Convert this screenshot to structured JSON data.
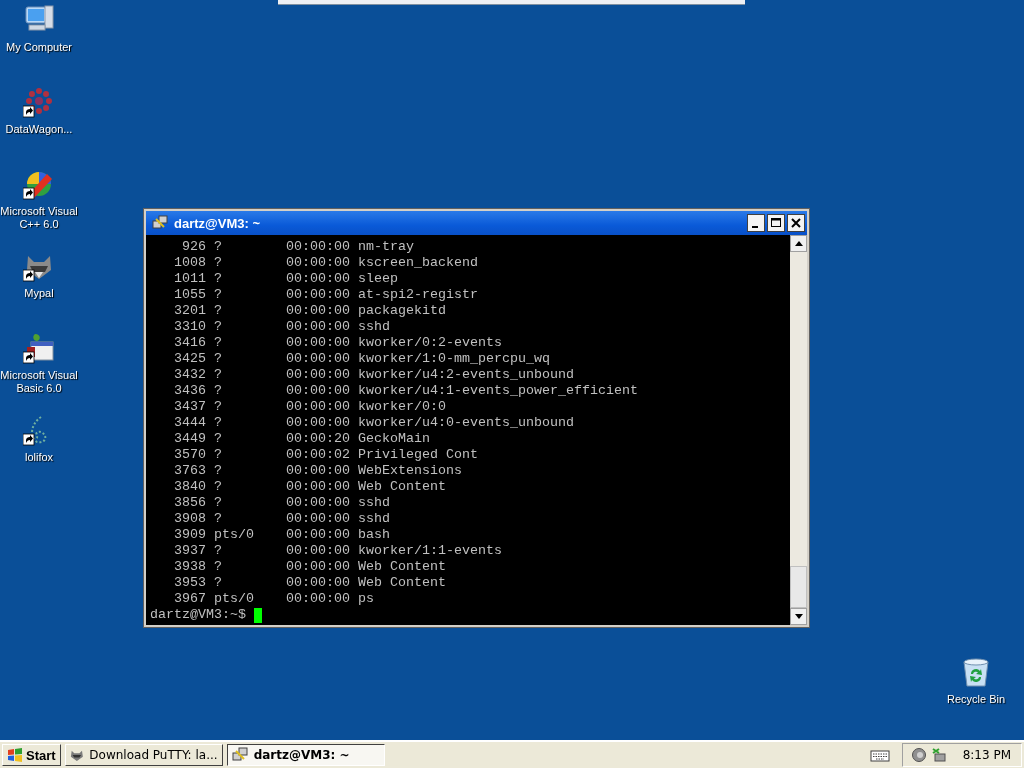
{
  "desktop_icons": [
    {
      "label": "My Computer",
      "kind": "computer",
      "shortcut": false
    },
    {
      "label": "DataWagon...",
      "kind": "dots",
      "shortcut": true
    },
    {
      "label": "Microsoft Visual C++ 6.0",
      "kind": "studio",
      "shortcut": true
    },
    {
      "label": "Mypal",
      "kind": "animal",
      "shortcut": true
    },
    {
      "label": "Microsoft Visual Basic 6.0",
      "kind": "basic",
      "shortcut": true
    },
    {
      "label": "lolifox",
      "kind": "outline",
      "shortcut": true
    }
  ],
  "terminal": {
    "title": "dartz@VM3: ~",
    "lines": [
      "    926 ?        00:00:00 nm-tray",
      "   1008 ?        00:00:00 kscreen_backend",
      "   1011 ?        00:00:00 sleep",
      "   1055 ?        00:00:00 at-spi2-registr",
      "   3201 ?        00:00:00 packagekitd",
      "   3310 ?        00:00:00 sshd",
      "   3416 ?        00:00:00 kworker/0:2-events",
      "   3425 ?        00:00:00 kworker/1:0-mm_percpu_wq",
      "   3432 ?        00:00:00 kworker/u4:2-events_unbound",
      "   3436 ?        00:00:00 kworker/u4:1-events_power_efficient",
      "   3437 ?        00:00:00 kworker/0:0",
      "   3444 ?        00:00:00 kworker/u4:0-events_unbound",
      "   3449 ?        00:00:20 GeckoMain",
      "   3570 ?        00:00:02 Privileged Cont",
      "   3763 ?        00:00:00 WebExtensions",
      "   3840 ?        00:00:00 Web Content",
      "   3856 ?        00:00:00 sshd",
      "   3908 ?        00:00:00 sshd",
      "   3909 pts/0    00:00:00 bash",
      "   3937 ?        00:00:00 kworker/1:1-events",
      "   3938 ?        00:00:00 Web Content",
      "   3953 ?        00:00:00 Web Content",
      "   3967 pts/0    00:00:00 ps"
    ],
    "prompt": "dartz@VM3:~$"
  },
  "recycle_bin": {
    "label": "Recycle Bin"
  },
  "taskbar": {
    "start": "Start",
    "tasks": [
      {
        "label": "Download PuTTY: la...",
        "kind": "browser",
        "selected": false
      },
      {
        "label": "dartz@VM3: ~",
        "kind": "terminal",
        "selected": true
      }
    ],
    "clock": "8:13 PM"
  }
}
